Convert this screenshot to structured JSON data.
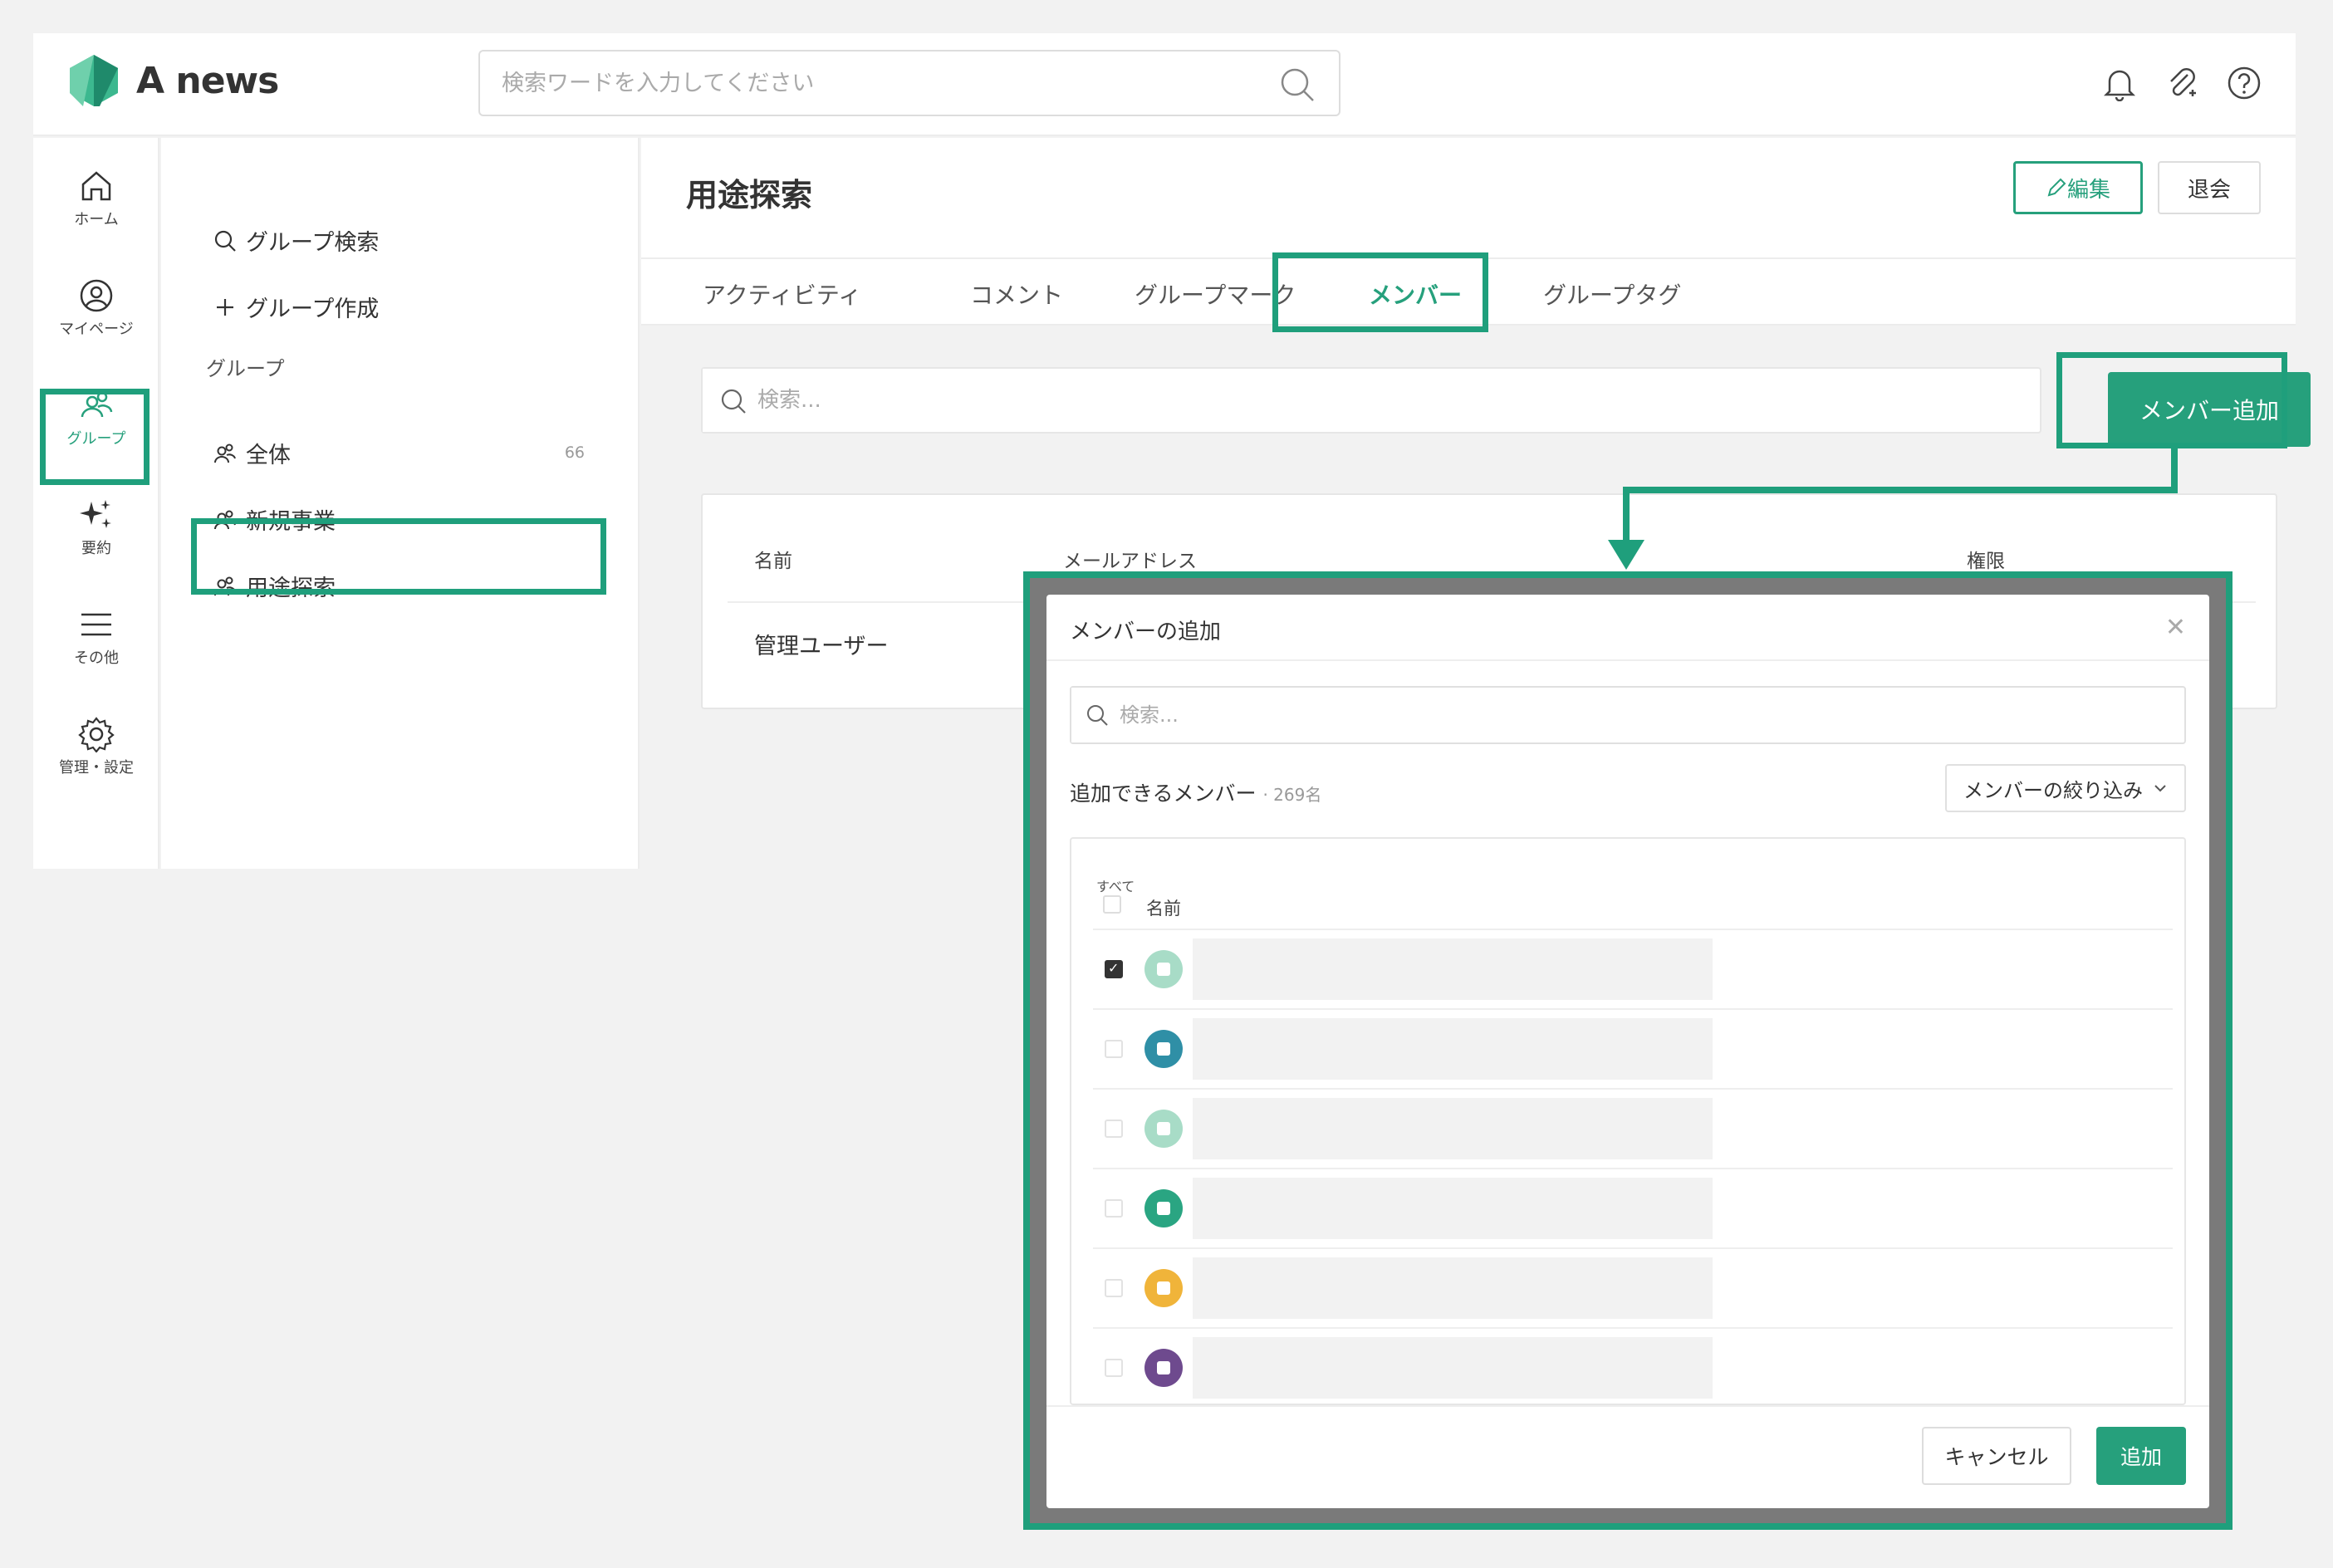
{
  "app": {
    "name": "A news"
  },
  "topbar": {
    "search_placeholder": "検索ワードを入力してください"
  },
  "rail": {
    "items": [
      {
        "label": "ホーム",
        "icon": "home-icon"
      },
      {
        "label": "マイページ",
        "icon": "user-circle-icon"
      },
      {
        "label": "グループ",
        "icon": "group-icon"
      },
      {
        "label": "要約",
        "icon": "sparkle-icon"
      },
      {
        "label": "その他",
        "icon": "menu-icon"
      },
      {
        "label": "管理・設定",
        "icon": "gear-icon"
      }
    ]
  },
  "sidebar": {
    "search_group": "グループ検索",
    "create_group": "グループ作成",
    "heading": "グループ",
    "groups": [
      {
        "label": "全体",
        "count": "66"
      },
      {
        "label": "新規事業"
      },
      {
        "label": "用途探索"
      }
    ]
  },
  "main": {
    "title": "用途探索",
    "edit_label": "編集",
    "leave_label": "退会",
    "tabs": [
      "アクティビティ",
      "コメント",
      "グループマーク",
      "メンバー",
      "グループタグ"
    ],
    "search_placeholder": "検索...",
    "add_member_label": "メンバー追加",
    "columns": {
      "name": "名前",
      "email": "メールアドレス",
      "role": "権限"
    },
    "rows": [
      {
        "name": "管理ユーザー"
      }
    ]
  },
  "modal": {
    "title": "メンバーの追加",
    "search_placeholder": "検索...",
    "available_label": "追加できるメンバー",
    "available_count": "· 269名",
    "filter_label": "メンバーの絞り込み",
    "all_label": "すべて",
    "name_header": "名前",
    "cancel_label": "キャンセル",
    "add_label": "追加"
  },
  "colors": {
    "accent": "#26a07c",
    "highlight": "#1f9f7c"
  }
}
